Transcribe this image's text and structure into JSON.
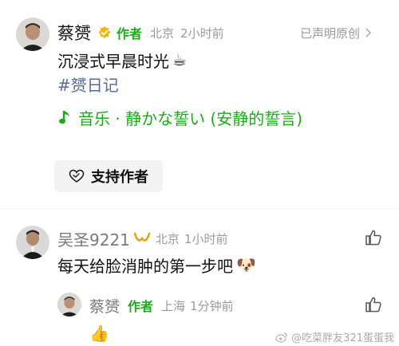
{
  "post": {
    "author": "蔡赟",
    "author_tag": "作者",
    "location": "北京",
    "time": "2小时前",
    "originality": "已声明原创",
    "text_line1": "沉浸式早晨时光",
    "text_line1_emoji": "☕",
    "hashtag": "#赟日记",
    "music_title": "音乐 · 静かな誓い (安静的誓言)",
    "support_label": "支持作者"
  },
  "comments": [
    {
      "user": "吴圣9221",
      "location": "北京",
      "time": "1小时前",
      "text": "每天给脸消肿的第一步吧",
      "emoji": "🐶"
    },
    {
      "user": "蔡赟",
      "author_tag": "作者",
      "location": "上海",
      "time": "1分钟前",
      "emoji": "👍"
    }
  ],
  "watermark": "@吃菜胖友321蛋蛋我",
  "colors": {
    "author_tag": "#1aad19",
    "hashtag": "#576b95",
    "meta": "#9a9a9a"
  },
  "icons": {
    "verified": "verified-badge-icon",
    "music": "music-note-icon",
    "heart": "heart-hands-icon",
    "like": "thumbs-up-icon",
    "more": "chevron-right-icon",
    "vip": "vip-badge-icon"
  }
}
